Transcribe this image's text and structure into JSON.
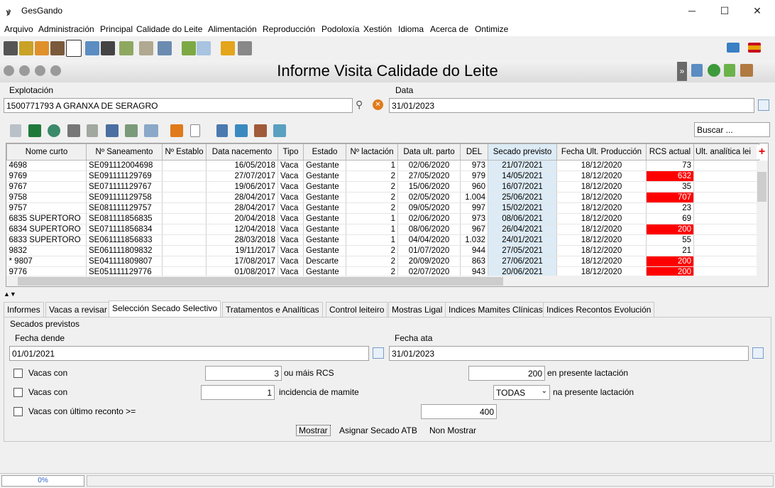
{
  "window": {
    "app_title": "GesGando",
    "app_icon_glyph": "ꝟ",
    "minimize": "─",
    "maximize": "☐",
    "close": "✕"
  },
  "menu": [
    "Arquivo",
    "Administración",
    "Principal",
    "Calidade do Leite",
    "Alimentación",
    "Reproducción",
    "Podoloxía",
    "Xestión",
    "Idioma",
    "Acerca de",
    "Ontimize"
  ],
  "form": {
    "title": "Informe Visita Calidade do Leite"
  },
  "explotacion": {
    "label": "Explotación",
    "value": "1500771793 A GRANXA DE SERAGRO"
  },
  "data_field": {
    "label": "Data",
    "value": "31/01/2023"
  },
  "search": {
    "placeholder": "Buscar ..."
  },
  "grid": {
    "columns": [
      "Nome curto",
      "Nº Saneamento",
      "Nº Establo",
      "Data nacemento",
      "Tipo",
      "Estado",
      "Nº lactación",
      "Data ult. parto",
      "DEL",
      "Secado previsto",
      "Fecha Ult. Producción",
      "RCS actual",
      "Ult. analítica lei"
    ],
    "rows": [
      [
        "4698",
        "SE091112004698",
        "",
        "16/05/2018",
        "Vaca",
        "Gestante",
        "1",
        "02/06/2020",
        "973",
        "21/07/2021",
        "18/12/2020",
        "73"
      ],
      [
        "9769",
        "SE091111129769",
        "",
        "27/07/2017",
        "Vaca",
        "Gestante",
        "2",
        "27/05/2020",
        "979",
        "14/05/2021",
        "18/12/2020",
        "632"
      ],
      [
        "9767",
        "SE071111129767",
        "",
        "19/06/2017",
        "Vaca",
        "Gestante",
        "2",
        "15/06/2020",
        "960",
        "16/07/2021",
        "18/12/2020",
        "35"
      ],
      [
        "9758",
        "SE091111129758",
        "",
        "28/04/2017",
        "Vaca",
        "Gestante",
        "2",
        "02/05/2020",
        "1.004",
        "25/06/2021",
        "18/12/2020",
        "707"
      ],
      [
        "9757",
        "SE081111129757",
        "",
        "28/04/2017",
        "Vaca",
        "Gestante",
        "2",
        "09/05/2020",
        "997",
        "15/02/2021",
        "18/12/2020",
        "23"
      ],
      [
        "6835 SUPERTORO",
        "SE081111856835",
        "",
        "20/04/2018",
        "Vaca",
        "Gestante",
        "1",
        "02/06/2020",
        "973",
        "08/06/2021",
        "18/12/2020",
        "69"
      ],
      [
        "6834 SUPERTORO",
        "SE071111856834",
        "",
        "12/04/2018",
        "Vaca",
        "Gestante",
        "1",
        "08/06/2020",
        "967",
        "26/04/2021",
        "18/12/2020",
        "200"
      ],
      [
        "6833 SUPERTORO",
        "SE061111856833",
        "",
        "28/03/2018",
        "Vaca",
        "Gestante",
        "1",
        "04/04/2020",
        "1.032",
        "24/01/2021",
        "18/12/2020",
        "55"
      ],
      [
        "9832",
        "SE061111809832",
        "",
        "19/11/2017",
        "Vaca",
        "Gestante",
        "2",
        "01/07/2020",
        "944",
        "27/05/2021",
        "18/12/2020",
        "21"
      ],
      [
        "* 9807",
        "SE041111809807",
        "",
        "17/08/2017",
        "Vaca",
        "Descarte",
        "2",
        "20/09/2020",
        "863",
        "27/06/2021",
        "18/12/2020",
        "200"
      ],
      [
        "9776",
        "SE051111129776",
        "",
        "01/08/2017",
        "Vaca",
        "Gestante",
        "2",
        "02/07/2020",
        "943",
        "20/06/2021",
        "18/12/2020",
        "200"
      ]
    ],
    "red_rcs": [
      "632",
      "707",
      "200"
    ]
  },
  "tabs": [
    "Informes",
    "Vacas a revisar",
    "Selección Secado Selectivo",
    "Tratamentos e Analíticas",
    "Control leiteiro",
    "Mostras Ligal",
    "Indices Mamites Clínicas",
    "Indices Recontos Evolución"
  ],
  "panel": {
    "group_title": "Secados previstos",
    "fecha_dende_label": "Fecha dende",
    "fecha_dende_value": "01/01/2021",
    "fecha_ata_label": "Fecha ata",
    "fecha_ata_value": "31/01/2023",
    "row1": {
      "label": "Vacas con",
      "value": "3",
      "mid_label": "ou máis RCS",
      "value2": "200",
      "end_label": "en presente lactación"
    },
    "row2": {
      "label": "Vacas con",
      "value": "1",
      "mid_label": "incidencia de mamite",
      "select": "TODAS",
      "end_label": "na presente lactación"
    },
    "row3": {
      "label": "Vacas con último reconto >=",
      "value": "400"
    },
    "buttons": {
      "mostrar": "Mostrar",
      "asignar": "Asignar Secado ATB",
      "non_mostrar": "Non Mostrar"
    }
  },
  "status": {
    "progress": "0%"
  }
}
